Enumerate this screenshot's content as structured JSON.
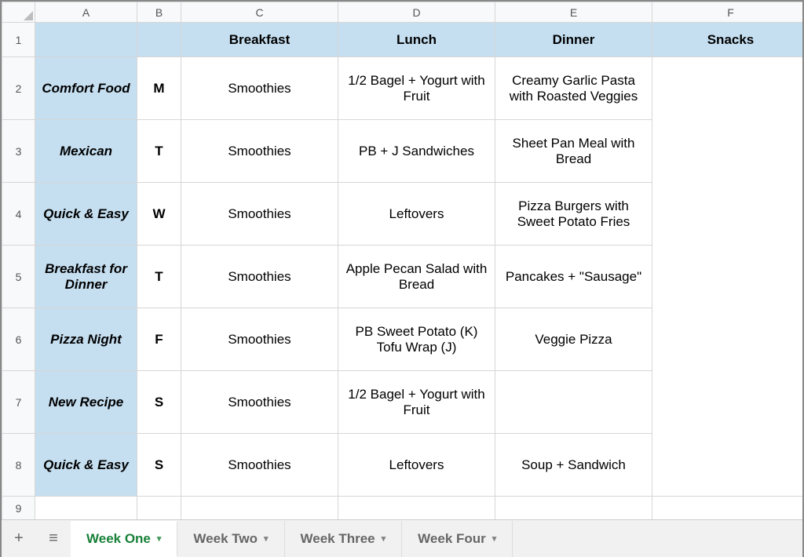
{
  "columns": [
    "A",
    "B",
    "C",
    "D",
    "E",
    "F"
  ],
  "row_numbers": [
    "1",
    "2",
    "3",
    "4",
    "5",
    "6",
    "7",
    "8",
    "9"
  ],
  "headers": {
    "breakfast": "Breakfast",
    "lunch": "Lunch",
    "dinner": "Dinner",
    "snacks": "Snacks"
  },
  "rows": [
    {
      "theme": "Comfort Food",
      "day": "M",
      "breakfast": "Smoothies",
      "lunch": "1/2 Bagel + Yogurt with Fruit",
      "dinner": "Creamy Garlic Pasta with Roasted Veggies"
    },
    {
      "theme": "Mexican",
      "day": "T",
      "breakfast": "Smoothies",
      "lunch": "PB + J Sandwiches",
      "dinner": "Sheet Pan Meal with Bread"
    },
    {
      "theme": "Quick & Easy",
      "day": "W",
      "breakfast": "Smoothies",
      "lunch": "Leftovers",
      "dinner": "Pizza Burgers with Sweet Potato Fries"
    },
    {
      "theme": "Breakfast for Dinner",
      "day": "T",
      "breakfast": "Smoothies",
      "lunch": "Apple Pecan Salad with Bread",
      "dinner": "Pancakes + \"Sausage\""
    },
    {
      "theme": "Pizza Night",
      "day": "F",
      "breakfast": "Smoothies",
      "lunch": "PB Sweet Potato (K) Tofu Wrap (J)",
      "dinner": "Veggie Pizza"
    },
    {
      "theme": "New Recipe",
      "day": "S",
      "breakfast": "Smoothies",
      "lunch": "1/2 Bagel + Yogurt with Fruit",
      "dinner": ""
    },
    {
      "theme": "Quick & Easy",
      "day": "S",
      "breakfast": "Smoothies",
      "lunch": "Leftovers",
      "dinner": "Soup + Sandwich"
    }
  ],
  "tabs": [
    {
      "label": "Week One",
      "active": true
    },
    {
      "label": "Week Two",
      "active": false
    },
    {
      "label": "Week Three",
      "active": false
    },
    {
      "label": "Week Four",
      "active": false
    }
  ],
  "icons": {
    "plus": "+",
    "menu": "≡",
    "dropdown": "▾"
  }
}
